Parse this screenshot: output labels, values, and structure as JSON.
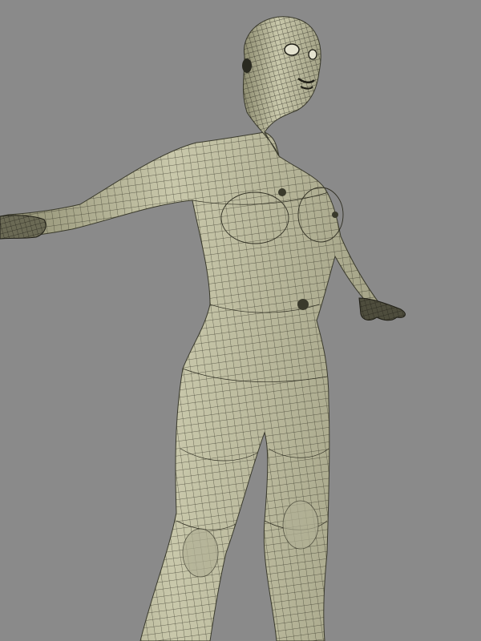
{
  "scene": {
    "background_color": "#8a8a8a",
    "subject": "3d-wireframe-female-mesh",
    "mesh_fill_color": "#c4c3a6",
    "mesh_shadow_color": "#8f8e72",
    "mesh_line_color": "#2f2e22"
  }
}
